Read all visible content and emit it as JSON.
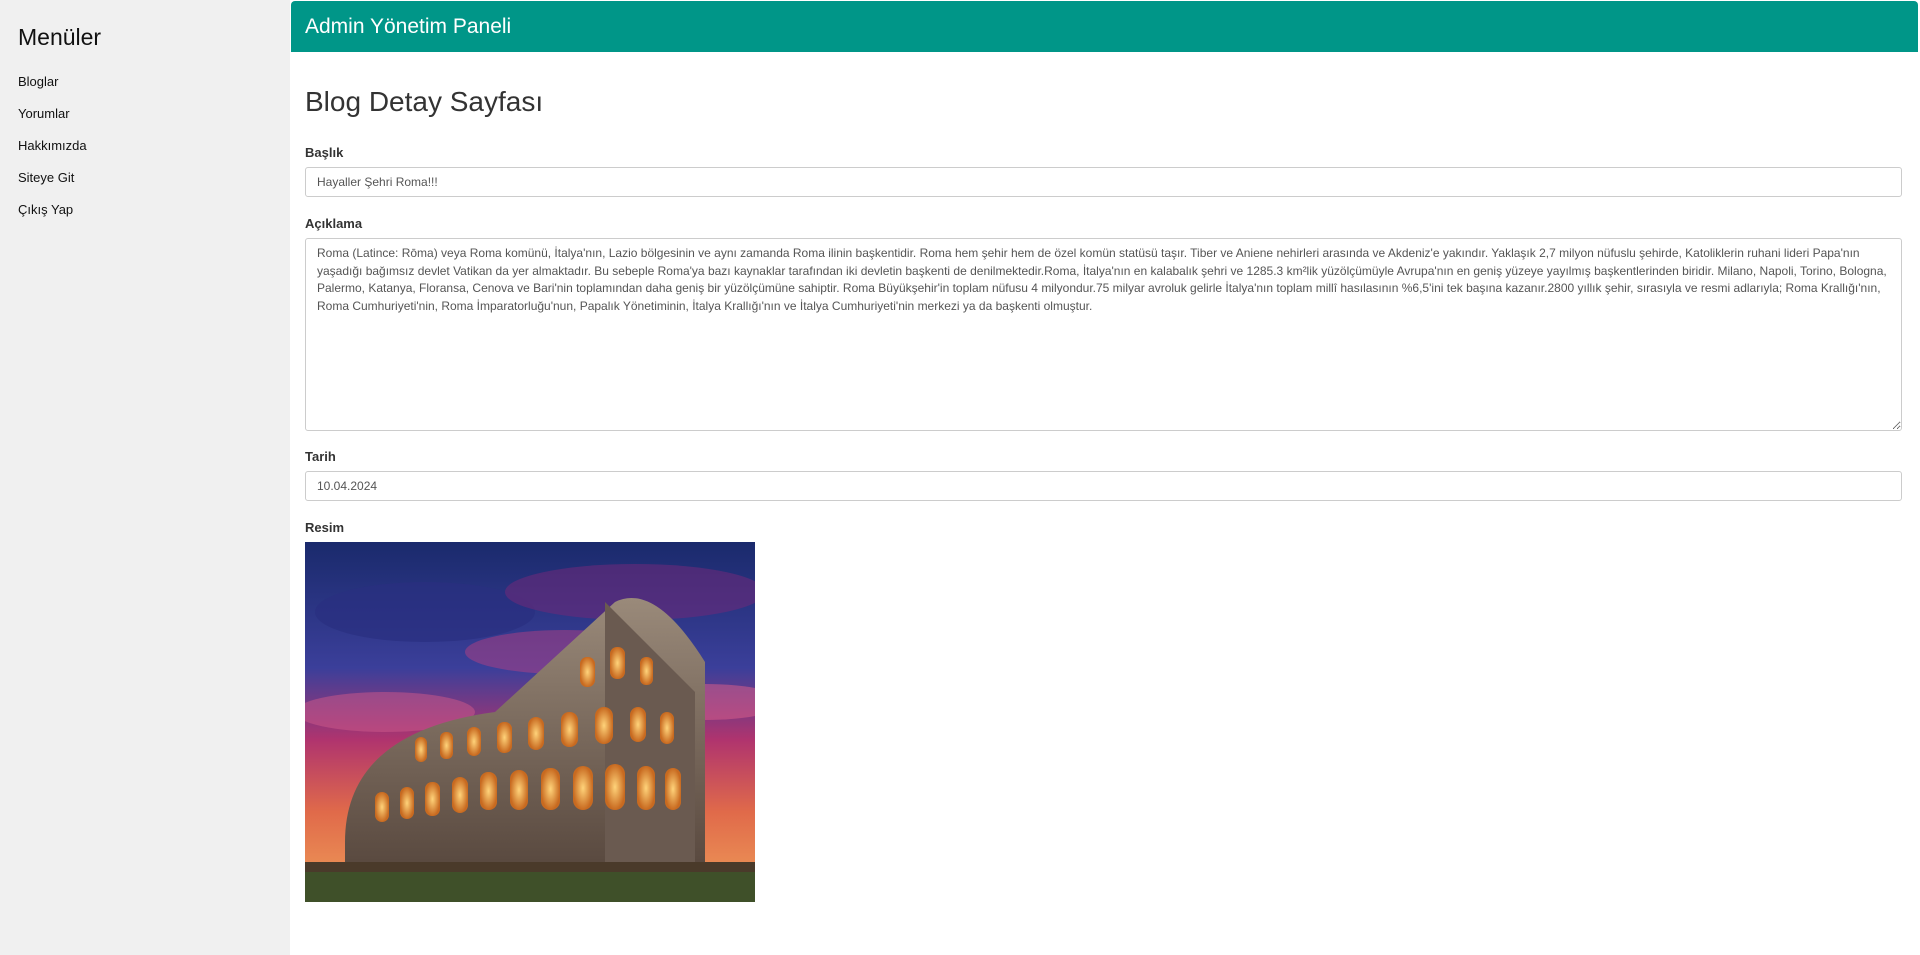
{
  "sidebar": {
    "title": "Menüler",
    "items": [
      {
        "label": "Bloglar"
      },
      {
        "label": "Yorumlar"
      },
      {
        "label": "Hakkımızda"
      },
      {
        "label": "Siteye Git"
      },
      {
        "label": "Çıkış Yap"
      }
    ]
  },
  "header": {
    "title": "Admin Yönetim Paneli"
  },
  "page": {
    "title": "Blog Detay Sayfası"
  },
  "form": {
    "title_label": "Başlık",
    "title_value": "Hayaller Şehri Roma!!!",
    "description_label": "Açıklama",
    "description_value": "Roma (Latince: Rōma) veya Roma komünü, İtalya'nın, Lazio bölgesinin ve aynı zamanda Roma ilinin başkentidir. Roma hem şehir hem de özel komün statüsü taşır. Tiber ve Aniene nehirleri arasında ve Akdeniz'e yakındır. Yaklaşık 2,7 milyon nüfuslu şehirde, Katoliklerin ruhani lideri Papa'nın yaşadığı bağımsız devlet Vatikan da yer almaktadır. Bu sebeple Roma'ya bazı kaynaklar tarafından iki devletin başkenti de denilmektedir.Roma, İtalya'nın en kalabalık şehri ve 1285.3 km²lik yüzölçümüyle Avrupa'nın en geniş yüzeye yayılmış başkentlerinden biridir. Milano, Napoli, Torino, Bologna, Palermo, Katanya, Floransa, Cenova ve Bari'nin toplamından daha geniş bir yüzölçümüne sahiptir. Roma Büyükşehir'in toplam nüfusu 4 milyondur.75 milyar avroluk gelirle İtalya'nın toplam millî hasılasının %6,5'ini tek başına kazanır.2800 yıllık şehir, sırasıyla ve resmi adlarıyla; Roma Krallığı'nın, Roma Cumhuriyeti'nin, Roma İmparatorluğu'nun, Papalık Yönetiminin, İtalya Krallığı'nın ve İtalya Cumhuriyeti'nin merkezi ya da başkenti olmuştur.",
    "date_label": "Tarih",
    "date_value": "10.04.2024",
    "image_label": "Resim"
  },
  "colors": {
    "header_bg": "#009688",
    "sidebar_bg": "#f0f0f0"
  }
}
